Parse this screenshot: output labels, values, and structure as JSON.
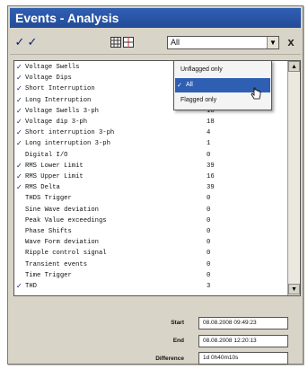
{
  "window": {
    "title": "Events - Analysis"
  },
  "toolbar": {
    "filter_value": "All",
    "close_label": "x",
    "icons": [
      "check-all-icon",
      "check-selected-icon",
      "grid-view-icon",
      "split-view-icon",
      "chevron-down-icon",
      "close-icon"
    ]
  },
  "filter_menu": {
    "options": [
      {
        "label": "Unflagged only",
        "selected": false
      },
      {
        "label": "All",
        "selected": true
      },
      {
        "label": "Flagged only",
        "selected": false
      }
    ]
  },
  "events": [
    {
      "name": "Voltage Swells",
      "count": "",
      "checked": true
    },
    {
      "name": "Voltage Dips",
      "count": "",
      "checked": true
    },
    {
      "name": "Short Interruption",
      "count": "",
      "checked": true
    },
    {
      "name": "Long Interruption",
      "count": "",
      "checked": true
    },
    {
      "name": "Voltage Swells 3-ph",
      "count": "18",
      "checked": true
    },
    {
      "name": "Voltage dip 3-ph",
      "count": "18",
      "checked": true
    },
    {
      "name": "Short interruption 3-ph",
      "count": "4",
      "checked": true
    },
    {
      "name": "Long interruption 3-ph",
      "count": "1",
      "checked": true
    },
    {
      "name": "Digital I/O",
      "count": "0",
      "checked": false
    },
    {
      "name": "RMS Lower Limit",
      "count": "39",
      "checked": true
    },
    {
      "name": "RMS Upper Limit",
      "count": "16",
      "checked": true
    },
    {
      "name": "RMS Delta",
      "count": "39",
      "checked": true
    },
    {
      "name": "THDS Trigger",
      "count": "0",
      "checked": false
    },
    {
      "name": "Sine Wave deviation",
      "count": "0",
      "checked": false
    },
    {
      "name": "Peak Value exceedings",
      "count": "0",
      "checked": false
    },
    {
      "name": "Phase Shifts",
      "count": "0",
      "checked": false
    },
    {
      "name": "Wave Form deviation",
      "count": "0",
      "checked": false
    },
    {
      "name": "Ripple control signal",
      "count": "0",
      "checked": false
    },
    {
      "name": "Transient events",
      "count": "0",
      "checked": false
    },
    {
      "name": "Time Trigger",
      "count": "0",
      "checked": false
    },
    {
      "name": "THD",
      "count": "3",
      "checked": true
    }
  ],
  "summary": {
    "start_label": "Start",
    "start_value": "08.08.2008 09:49:23",
    "end_label": "End",
    "end_value": "08.08.2008 12:20:13",
    "difference_label": "Difference",
    "difference_value": "1d 0h40m10s"
  },
  "colors": {
    "title_bar": "#2f5fb3",
    "selection": "#2f5fb3",
    "window_bg": "#d8d4c8"
  }
}
